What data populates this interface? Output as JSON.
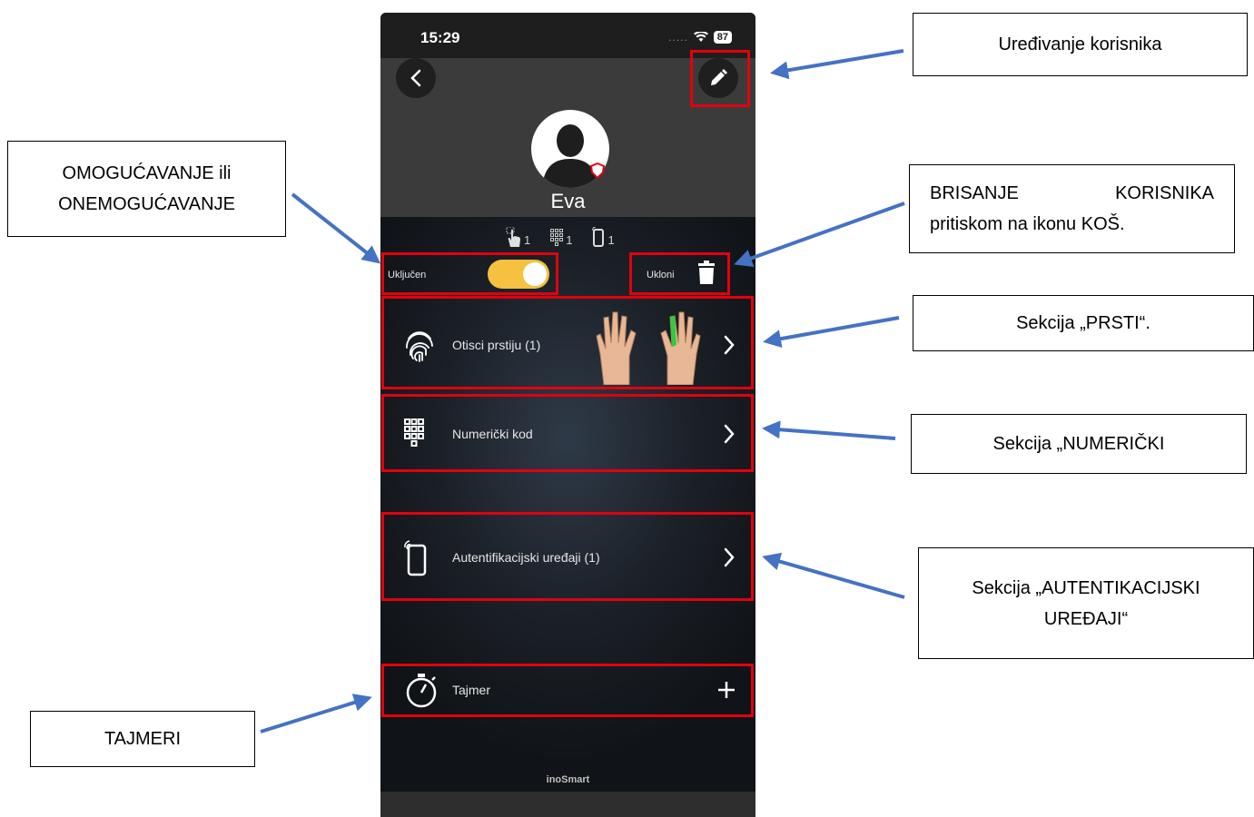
{
  "phone": {
    "status_time": "15:29",
    "battery": "87",
    "signal": ".....",
    "user_name": "Eva",
    "counts": {
      "fingerprints": "1",
      "keypad": "1",
      "devices": "1"
    },
    "enabled_label": "Uključen",
    "remove_label": "Ukloni",
    "toggle_on": true,
    "rows": [
      {
        "label": "Otisci prstiju (1)",
        "icon": "fingerprint-icon"
      },
      {
        "label": "Numerički kod",
        "icon": "keypad-icon"
      },
      {
        "label": "Autentifikacijski uređaji (1)",
        "icon": "phone-device-icon"
      },
      {
        "label": "Tajmer",
        "icon": "stopwatch-icon"
      }
    ],
    "brand": "inoSmart",
    "accent_color": "#f6c040"
  },
  "callouts": {
    "edit_user": "Uređivanje korisnika",
    "enable_line1": "OMOGUĆAVANJE ili",
    "enable_line2": "ONEMOGUĆAVANJE",
    "delete_line1_a": "BRISANJE",
    "delete_line1_b": "KORISNIKA",
    "delete_line2": "pritiskom na ikonu KOŠ.",
    "fingers": "Sekcija „PRSTI“.",
    "numeric": "Sekcija „NUMERIČKI",
    "auth_line1": "Sekcija „AUTENTIKACIJSKI",
    "auth_line2": "UREĐAJI“",
    "timers": "TAJMERI"
  },
  "colors": {
    "highlight": "#e3000f",
    "arrow": "#4472c4"
  }
}
